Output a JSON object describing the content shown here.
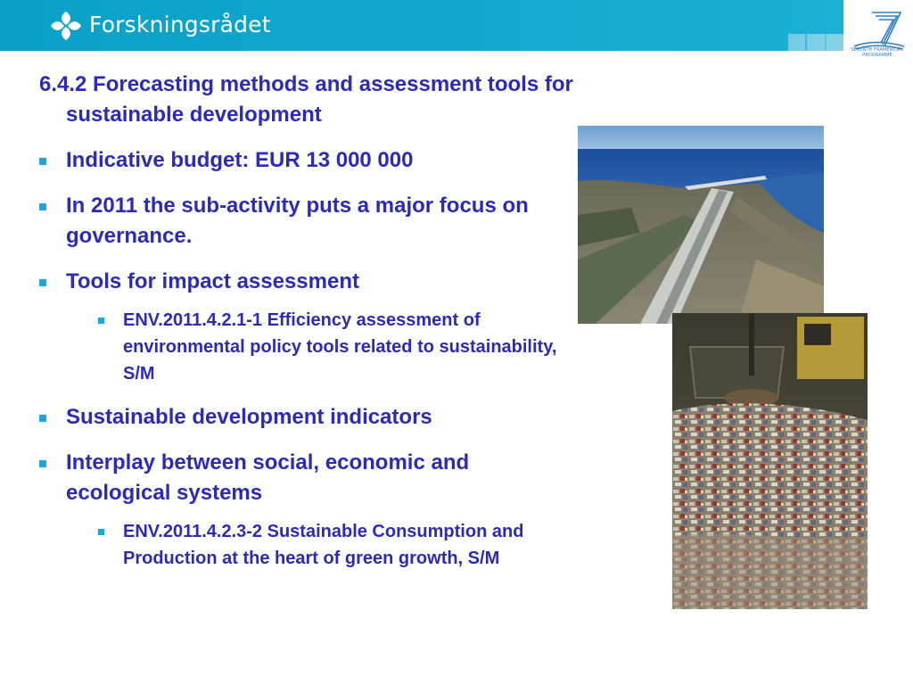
{
  "header": {
    "logo_text": "Forskningsrådet",
    "fp7_caption": "SEVENTH FRAMEWORK PROGRAMME"
  },
  "slide": {
    "heading": "6.4.2 Forecasting methods and assessment tools for sustainable development",
    "items": [
      {
        "level": 1,
        "text": "Indicative budget: EUR 13 000 000"
      },
      {
        "level": 1,
        "text": "In 2011 the sub-activity puts a major focus on governance."
      },
      {
        "level": 1,
        "text": "Tools for impact assessment"
      },
      {
        "level": 2,
        "text": "ENV.2011.4.2.1-1 Efficiency assessment of environmental policy tools related to sustainability, S/M"
      },
      {
        "level": 1,
        "text": "Sustainable development indicators"
      },
      {
        "level": 1,
        "text": "Interplay between social, economic and ecological systems"
      },
      {
        "level": 2,
        "text": "ENV.2011.4.2.3-2 Sustainable Consumption and Production at the heart of green growth, S/M"
      }
    ]
  },
  "colors": {
    "header": "#11a9cf",
    "text": "#2b2bb8",
    "bullet": "#1fa7d8"
  },
  "icons": {
    "header_logo": "forskningsradet-logo-icon",
    "fp7_logo": "fp7-logo-icon",
    "bullet": "square-bullet-icon"
  }
}
